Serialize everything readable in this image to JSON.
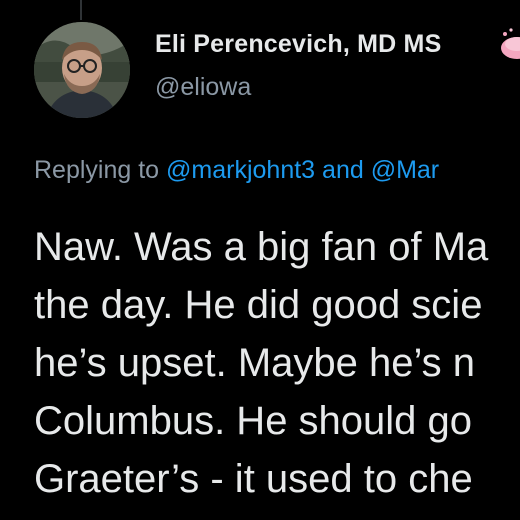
{
  "author": {
    "display_name": "Eli Perencevich, MD MS",
    "handle": "@eliowa",
    "avatar": "profile-photo"
  },
  "reply_context": {
    "prefix": "Replying to ",
    "mention_1": "@markjohnt3",
    "conjunction": " and ",
    "mention_2": "@Mar"
  },
  "tweet": {
    "lines": [
      "Naw. Was a big fan of Ma",
      "the day. He did good scie",
      "he’s upset. Maybe he’s n",
      "Columbus. He should go",
      "Graeter’s - it used to che"
    ]
  },
  "colors": {
    "background": "#000000",
    "primary_text": "#e7e9ea",
    "secondary_text": "#8b98a5",
    "link": "#1d9bf0",
    "badge": "#f4a6c0"
  },
  "icons": {
    "badge": "pink-emoji-icon"
  }
}
